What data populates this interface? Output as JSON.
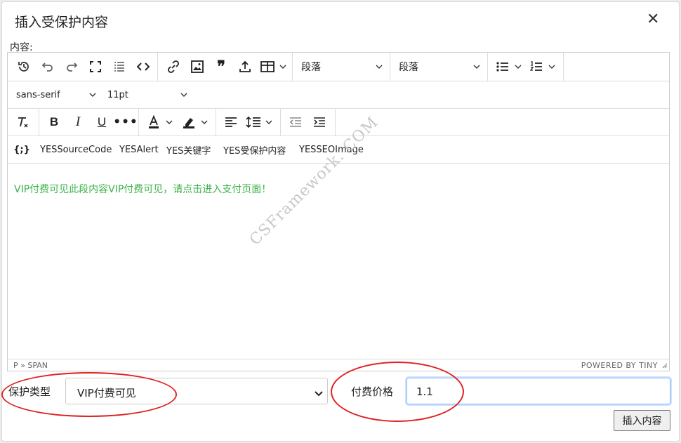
{
  "dialog": {
    "title": "插入受保护内容",
    "close_glyph": "✕",
    "content_label": "内容:"
  },
  "toolbar": {
    "block_format_1": "段落",
    "block_format_2": "段落",
    "font_family": "sans-serif",
    "font_size": "11pt",
    "custom_buttons": [
      "YESSourceCode",
      "YESAlert",
      "YES关键字",
      "YES受保护内容",
      "YESSEOImage"
    ]
  },
  "editor": {
    "body_text": "VIP付费可见此段内容VIP付费可见，请点击进入支付页面！",
    "body_text_color": "#3cb34a",
    "watermark": "CSFramework. COM",
    "status_path": "P » SPAN",
    "status_brand": "POWERED BY TINY"
  },
  "form": {
    "protect_type_label": "保护类型",
    "protect_type_value": "VIP付费可见",
    "price_label": "付费价格",
    "price_value": "1.1",
    "insert_button": "插入内容"
  },
  "colors": {
    "annotation_circle": "#e02020",
    "focus_border": "#86b7fe"
  }
}
